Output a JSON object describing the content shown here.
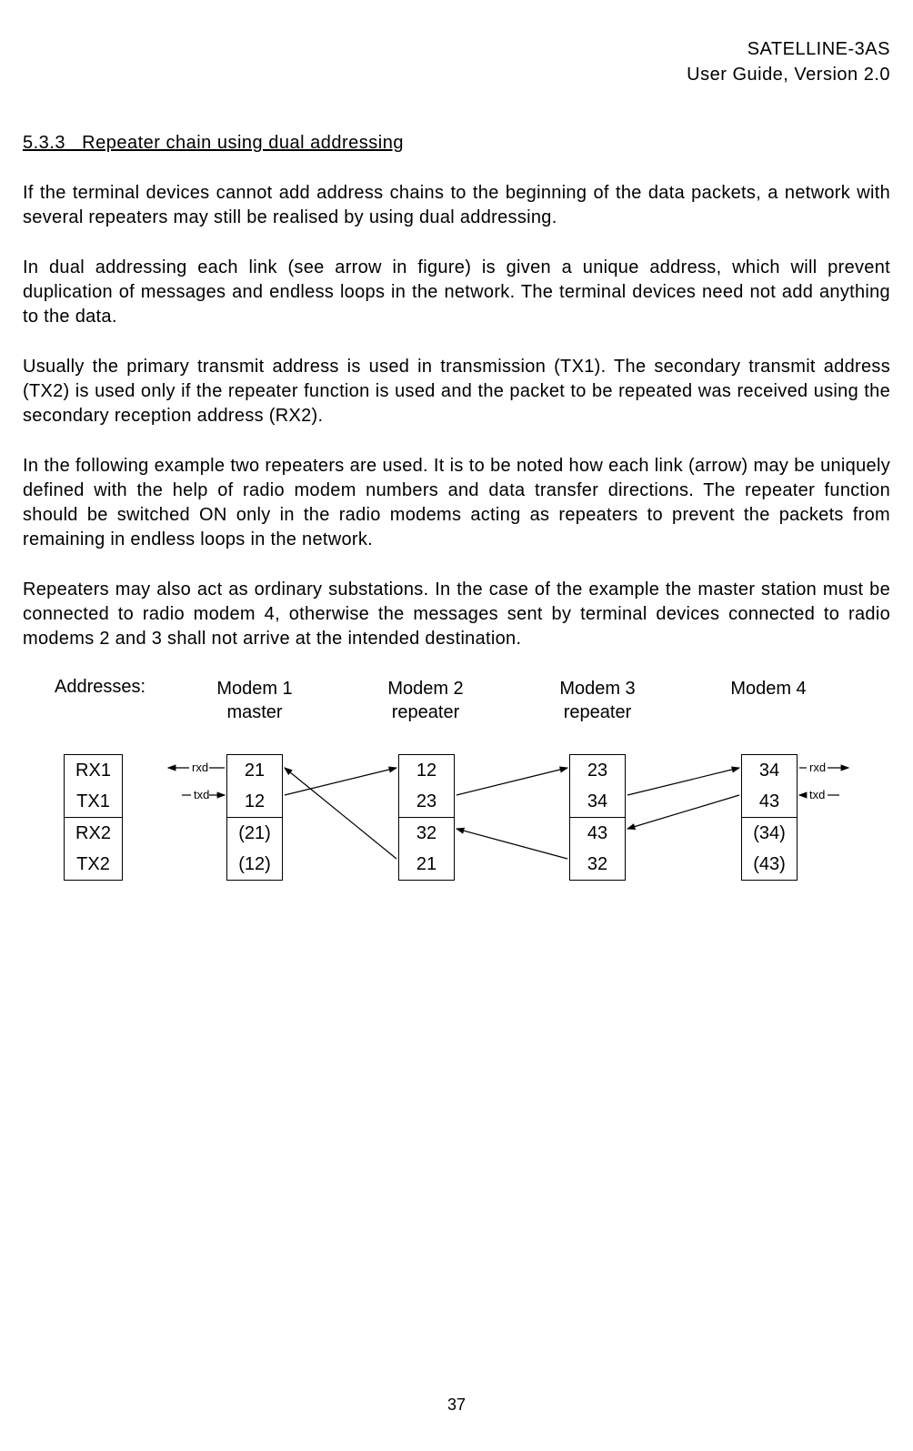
{
  "header": {
    "line1": "SATELLINE-3AS",
    "line2": "User Guide, Version 2.0"
  },
  "section": {
    "number": "5.3.3",
    "title": "Repeater chain using dual addressing"
  },
  "paragraphs": {
    "p1": "If the terminal devices cannot add address chains to the beginning of the data packets, a network with several repeaters may still be realised by using dual addressing.",
    "p2": "In dual addressing each link (see arrow in figure) is given a unique address, which will prevent duplication of messages and endless loops in the network. The terminal devices need not add anything to the data.",
    "p3": "Usually the primary transmit address is used in transmission (TX1). The secondary transmit address (TX2) is used only if the repeater function is used and the packet to be repeated was received using the secondary reception address (RX2).",
    "p4": "In the following example two repeaters are used. It is to be noted how each link (arrow) may be uniquely defined with the help of radio modem numbers and data transfer directions. The repeater function should be switched ON only in the radio modems acting as repeaters to prevent the packets from remaining in endless loops in the network.",
    "p5": "Repeaters may also act as ordinary substations. In the case of the example the master station must be connected to radio modem 4, otherwise the messages sent by terminal devices connected to radio modems 2 and 3 shall not arrive at the intended destination."
  },
  "diagram": {
    "addresses_label": "Addresses:",
    "legend": [
      "RX1",
      "TX1",
      "RX2",
      "TX2"
    ],
    "modems": [
      {
        "name": "Modem 1",
        "role": "master",
        "values": [
          "21",
          "12",
          "(21)",
          "(12)"
        ]
      },
      {
        "name": "Modem 2",
        "role": "repeater",
        "values": [
          "12",
          "23",
          "32",
          "21"
        ]
      },
      {
        "name": "Modem 3",
        "role": "repeater",
        "values": [
          "23",
          "34",
          "43",
          "32"
        ]
      },
      {
        "name": "Modem 4",
        "role": "",
        "values": [
          "34",
          "43",
          "(34)",
          "(43)"
        ]
      }
    ],
    "rxd": "rxd",
    "txd": "txd"
  },
  "page_number": "37"
}
